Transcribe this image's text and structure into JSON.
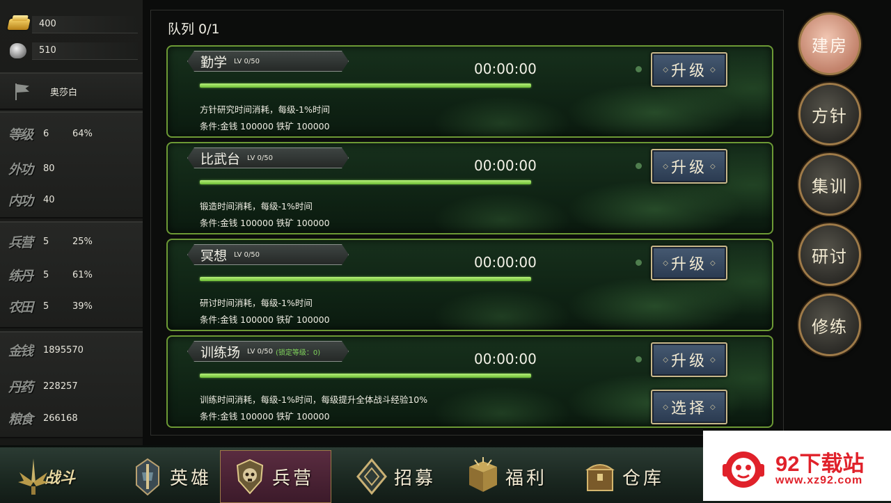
{
  "resources": {
    "gold_bars": "400",
    "iron_ore": "510"
  },
  "player": {
    "name": "奥莎白"
  },
  "stats": [
    {
      "label": "等级",
      "v1": "6",
      "v2": "64%"
    },
    {
      "label": "外功",
      "v1": "80",
      "v2": ""
    },
    {
      "label": "内功",
      "v1": "40",
      "v2": ""
    },
    {
      "label": "兵营",
      "v1": "5",
      "v2": "25%"
    },
    {
      "label": "练丹",
      "v1": "5",
      "v2": "61%"
    },
    {
      "label": "农田",
      "v1": "5",
      "v2": "39%"
    },
    {
      "label": "金钱",
      "v1": "1895570",
      "v2": ""
    },
    {
      "label": "丹药",
      "v1": "228257",
      "v2": ""
    },
    {
      "label": "粮食",
      "v1": "266168",
      "v2": ""
    }
  ],
  "queue": {
    "title": "队列 0/1"
  },
  "buildings": [
    {
      "name": "勤学",
      "level": "LV 0/50",
      "lock": "",
      "timer": "00:00:00",
      "progress": 1.0,
      "desc": "方针研究时间消耗，每级-1%时间",
      "cond": "条件:金钱 100000 铁矿 100000",
      "button": "升级"
    },
    {
      "name": "比武台",
      "level": "LV 0/50",
      "lock": "",
      "timer": "00:00:00",
      "progress": 1.0,
      "desc": "锻造时间消耗，每级-1%时间",
      "cond": "条件:金钱 100000 铁矿 100000",
      "button": "升级"
    },
    {
      "name": "冥想",
      "level": "LV 0/50",
      "lock": "",
      "timer": "00:00:00",
      "progress": 1.0,
      "desc": "研讨时间消耗，每级-1%时间",
      "cond": "条件:金钱 100000 铁矿 100000",
      "button": "升级"
    },
    {
      "name": "训练场",
      "level": "LV 0/50",
      "lock": "(锁定等级：0)",
      "timer": "00:00:00",
      "progress": 1.0,
      "desc": "训练时间消耗，每级-1%时间，每级提升全体战斗经验10%",
      "cond": "条件:金钱 100000 铁矿 100000",
      "button": "升级",
      "button2": "选择"
    }
  ],
  "side_menu": [
    {
      "label": "建房",
      "active": true
    },
    {
      "label": "方针",
      "active": false
    },
    {
      "label": "集训",
      "active": false
    },
    {
      "label": "研讨",
      "active": false
    },
    {
      "label": "修练",
      "active": false
    }
  ],
  "bottom_nav": [
    {
      "label": "战斗",
      "icon": "sword-wings-icon",
      "active": false
    },
    {
      "label": "英雄",
      "icon": "helmet-icon",
      "active": false
    },
    {
      "label": "兵营",
      "icon": "skull-shield-icon",
      "active": true
    },
    {
      "label": "招募",
      "icon": "diamond-emblem-icon",
      "active": false
    },
    {
      "label": "福利",
      "icon": "gift-chest-icon",
      "active": false
    },
    {
      "label": "仓库",
      "icon": "treasure-chest-icon",
      "active": false
    }
  ],
  "watermark": {
    "title": "92下载站",
    "url": "www.xz92.com"
  },
  "colors": {
    "card_border": "#6d9a35",
    "progress": "#8fd64f",
    "active_round": "#c2826b",
    "active_tab": "#5a2c40",
    "watermark_red": "#e0212a"
  }
}
